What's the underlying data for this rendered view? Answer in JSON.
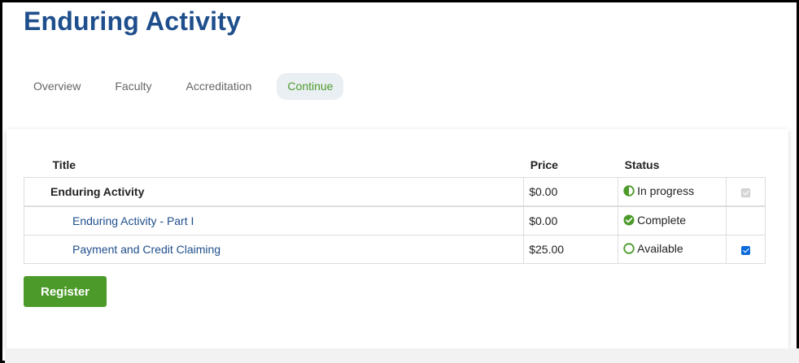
{
  "page": {
    "title": "Enduring Activity"
  },
  "tabs": [
    {
      "label": "Overview",
      "active": false
    },
    {
      "label": "Faculty",
      "active": false
    },
    {
      "label": "Accreditation",
      "active": false
    },
    {
      "label": "Continue",
      "active": true
    }
  ],
  "table": {
    "headers": {
      "title": "Title",
      "price": "Price",
      "status": "Status"
    },
    "rows": [
      {
        "title": "Enduring Activity",
        "price": "$0.00",
        "status": "In progress",
        "status_icon": "half-circle-icon",
        "checkbox": "checked-disabled"
      },
      {
        "title": "Enduring Activity - Part I",
        "price": "$0.00",
        "status": "Complete",
        "status_icon": "check-circle-icon",
        "checkbox": "none"
      },
      {
        "title": "Payment and Credit Claiming",
        "price": "$25.00",
        "status": "Available",
        "status_icon": "open-circle-icon",
        "checkbox": "checked"
      }
    ]
  },
  "actions": {
    "register_label": "Register"
  },
  "colors": {
    "title": "#1e4e8c",
    "accent_green": "#4c9a2a",
    "link": "#1e4e8c",
    "checkbox_blue": "#0b6ad9"
  }
}
